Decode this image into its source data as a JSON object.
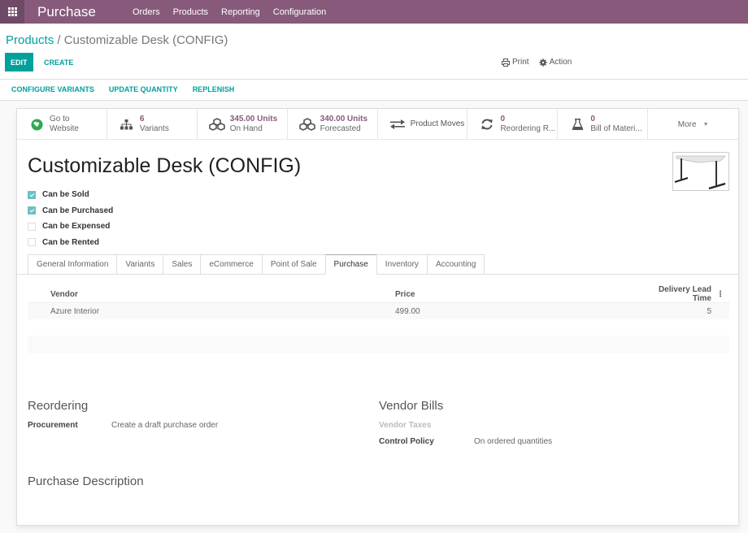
{
  "navbar": {
    "apps_icon": "grid-icon",
    "brand": "Purchase",
    "menu": [
      "Orders",
      "Products",
      "Reporting",
      "Configuration"
    ],
    "color": "#875a7b"
  },
  "breadcrumb": {
    "parent": "Products",
    "separator": " / ",
    "current": "Customizable Desk (CONFIG)"
  },
  "toolbar": {
    "edit_label": "EDIT",
    "create_label": "CREATE",
    "print_label": "Print",
    "action_label": "Action",
    "accent": "#00a09d"
  },
  "header_buttons": [
    "CONFIGURE VARIANTS",
    "UPDATE QUANTITY",
    "REPLENISH"
  ],
  "stat_buttons": [
    {
      "icon": "globe-icon",
      "value": "",
      "label": "Go to",
      "label2": "Website"
    },
    {
      "icon": "sitemap-icon",
      "value": "6",
      "label": "Variants"
    },
    {
      "icon": "cubes-icon",
      "value": "345.00 Units",
      "label": "On Hand"
    },
    {
      "icon": "cubes-icon",
      "value": "340.00 Units",
      "label": "Forecasted"
    },
    {
      "icon": "exchange-icon",
      "value": "",
      "label": "Product Moves"
    },
    {
      "icon": "refresh-icon",
      "value": "0",
      "label": "Reordering R..."
    },
    {
      "icon": "flask-icon",
      "value": "0",
      "label": "Bill of Materi..."
    },
    {
      "icon": "caret-down-icon",
      "value": "",
      "label": "More"
    }
  ],
  "product": {
    "name": "Customizable Desk (CONFIG)",
    "image": "desk-image"
  },
  "options": [
    {
      "label": "Can be Sold",
      "checked": true
    },
    {
      "label": "Can be Purchased",
      "checked": true
    },
    {
      "label": "Can be Expensed",
      "checked": false
    },
    {
      "label": "Can be Rented",
      "checked": false
    }
  ],
  "tabs": [
    {
      "label": "General Information",
      "active": false
    },
    {
      "label": "Variants",
      "active": false
    },
    {
      "label": "Sales",
      "active": false
    },
    {
      "label": "eCommerce",
      "active": false
    },
    {
      "label": "Point of Sale",
      "active": false
    },
    {
      "label": "Purchase",
      "active": true
    },
    {
      "label": "Inventory",
      "active": false
    },
    {
      "label": "Accounting",
      "active": false
    }
  ],
  "vendor_table": {
    "columns": [
      "Vendor",
      "Price",
      "Delivery Lead Time"
    ],
    "rows": [
      {
        "vendor": "Azure Interior",
        "price": "499.00",
        "lead_time": "5"
      }
    ]
  },
  "reordering": {
    "title": "Reordering",
    "fields": [
      {
        "label": "Procurement",
        "value": "Create a draft purchase order"
      }
    ]
  },
  "vendor_bills": {
    "title": "Vendor Bills",
    "fields": [
      {
        "label": "Vendor Taxes",
        "value": ""
      },
      {
        "label": "Control Policy",
        "value": "On ordered quantities"
      }
    ]
  },
  "purchase_description": {
    "title": "Purchase Description"
  }
}
